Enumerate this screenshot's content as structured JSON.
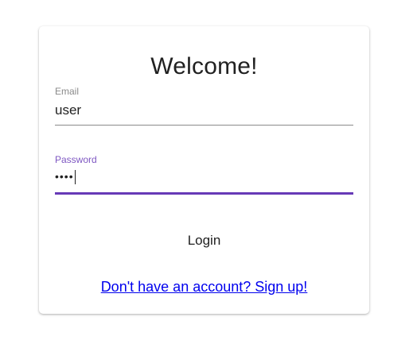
{
  "card": {
    "title": "Welcome!"
  },
  "email": {
    "label": "Email",
    "value": "user"
  },
  "password": {
    "label": "Password",
    "value": "••••"
  },
  "actions": {
    "login_label": "Login",
    "signup_link": "Don't have an account? Sign up!"
  },
  "colors": {
    "accent": "#673ab7",
    "link": "#0000ee",
    "text": "#212121",
    "muted": "#8a8a8a"
  }
}
